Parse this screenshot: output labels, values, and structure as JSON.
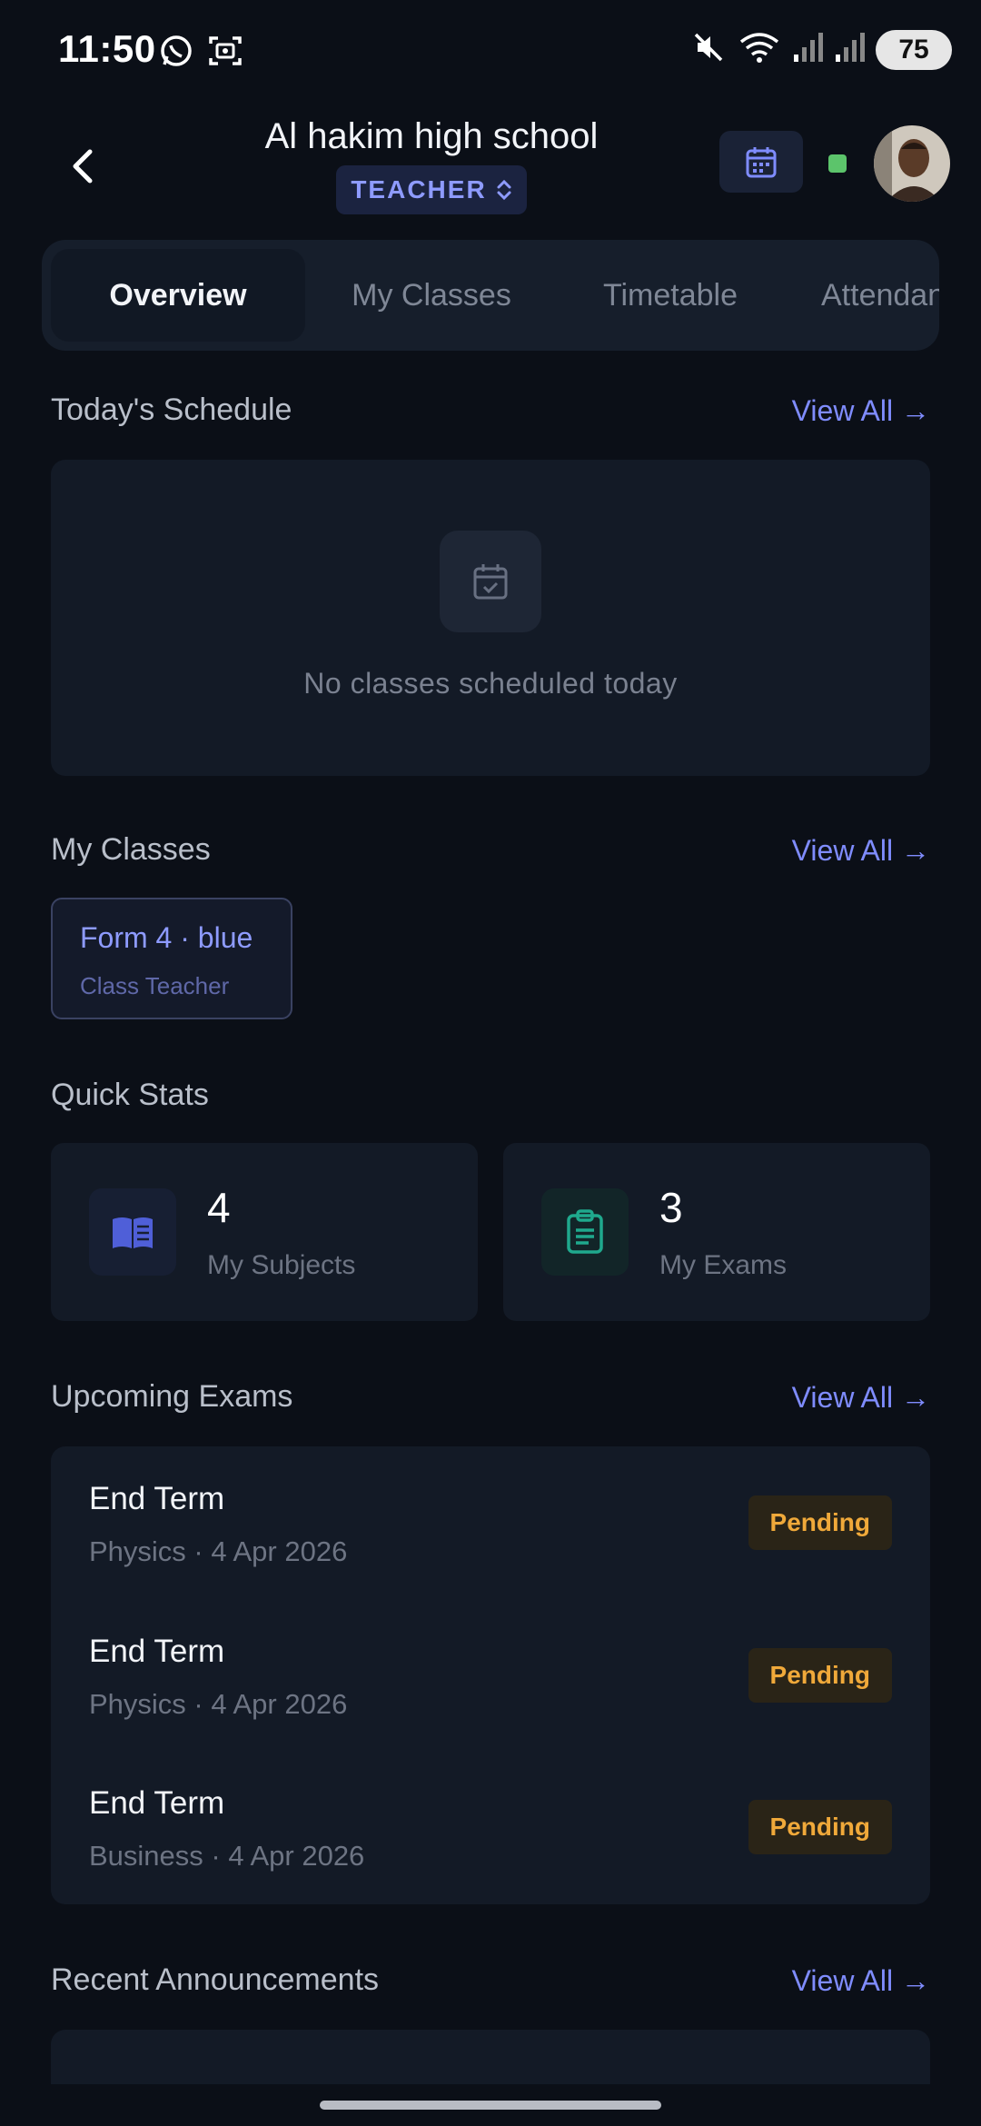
{
  "status_bar": {
    "time": "11:50",
    "battery": "75",
    "icons": [
      "whatsapp-icon",
      "screenshot-icon",
      "mute-icon",
      "wifi-icon",
      "signal-icon",
      "signal-icon"
    ]
  },
  "header": {
    "school_name": "Al hakim high school",
    "role": "TEACHER",
    "online_color": "#5cc46b"
  },
  "tabs": [
    {
      "label": "Overview",
      "active": true
    },
    {
      "label": "My Classes",
      "active": false
    },
    {
      "label": "Timetable",
      "active": false
    },
    {
      "label": "Attendance",
      "active": false
    }
  ],
  "schedule": {
    "title": "Today's Schedule",
    "view_all": "View All →",
    "empty_text": "No classes scheduled today"
  },
  "my_classes": {
    "title": "My Classes",
    "view_all": "View All →",
    "items": [
      {
        "name": "Form 4 · blue",
        "role": "Class Teacher"
      }
    ]
  },
  "quick_stats": {
    "title": "Quick Stats",
    "items": [
      {
        "value": "4",
        "label": "My Subjects",
        "icon": "book-icon",
        "color": "#4f5fd8"
      },
      {
        "value": "3",
        "label": "My Exams",
        "icon": "clipboard-icon",
        "color": "#1fa98d"
      }
    ]
  },
  "upcoming_exams": {
    "title": "Upcoming Exams",
    "view_all": "View All →",
    "items": [
      {
        "title": "End Term",
        "subtitle": "Physics · 4 Apr 2026",
        "status": "Pending"
      },
      {
        "title": "End Term",
        "subtitle": "Physics · 4 Apr 2026",
        "status": "Pending"
      },
      {
        "title": "End Term",
        "subtitle": "Business · 4 Apr 2026",
        "status": "Pending"
      }
    ]
  },
  "announcements": {
    "title": "Recent Announcements",
    "view_all": "View All →"
  },
  "colors": {
    "background": "#0b0f17",
    "card": "#131a26",
    "accent": "#7f8cff",
    "pending": "#f0a93a"
  }
}
